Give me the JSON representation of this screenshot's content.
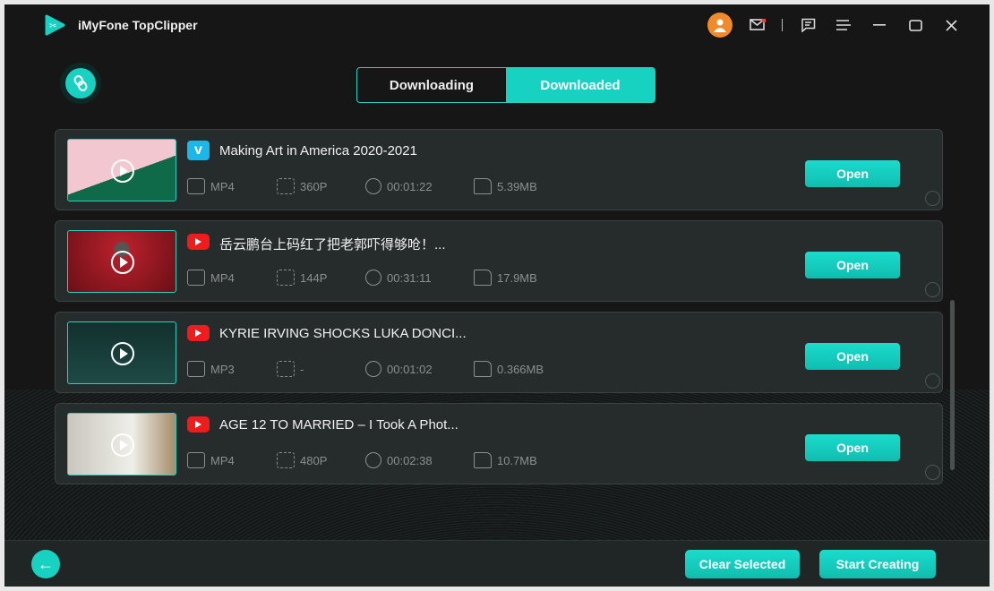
{
  "app": {
    "title": "iMyFone TopClipper"
  },
  "titlebar": {
    "icons": [
      "user-avatar",
      "mail-icon",
      "feedback-icon",
      "menu-icon",
      "minimize-icon",
      "maximize-icon",
      "close-icon"
    ],
    "mail_badge_color": "#ff3b3b"
  },
  "tabs": [
    {
      "label": "Downloading",
      "active": false
    },
    {
      "label": "Downloaded",
      "active": true
    }
  ],
  "accent": "#18d2c1",
  "items": [
    {
      "source": "vimeo",
      "title": "Making Art in America 2020-2021",
      "format": "MP4",
      "resolution": "360P",
      "duration": "00:01:22",
      "size": "5.39MB",
      "open_label": "Open",
      "selected": false
    },
    {
      "source": "youtube",
      "title": "岳云鹏台上码红了把老郭吓得够呛！...",
      "format": "MP4",
      "resolution": "144P",
      "duration": "00:31:11",
      "size": "17.9MB",
      "open_label": "Open",
      "selected": false
    },
    {
      "source": "youtube",
      "title": "KYRIE IRVING SHOCKS LUKA DONCI...",
      "format": "MP3",
      "resolution": "-",
      "duration": "00:01:02",
      "size": "0.366MB",
      "open_label": "Open",
      "selected": false
    },
    {
      "source": "youtube",
      "title": "AGE 12 TO MARRIED – I Took A Phot...",
      "format": "MP4",
      "resolution": "480P",
      "duration": "00:02:38",
      "size": "10.7MB",
      "open_label": "Open",
      "selected": false
    }
  ],
  "footer": {
    "clear_label": "Clear Selected",
    "start_label": "Start Creating"
  }
}
